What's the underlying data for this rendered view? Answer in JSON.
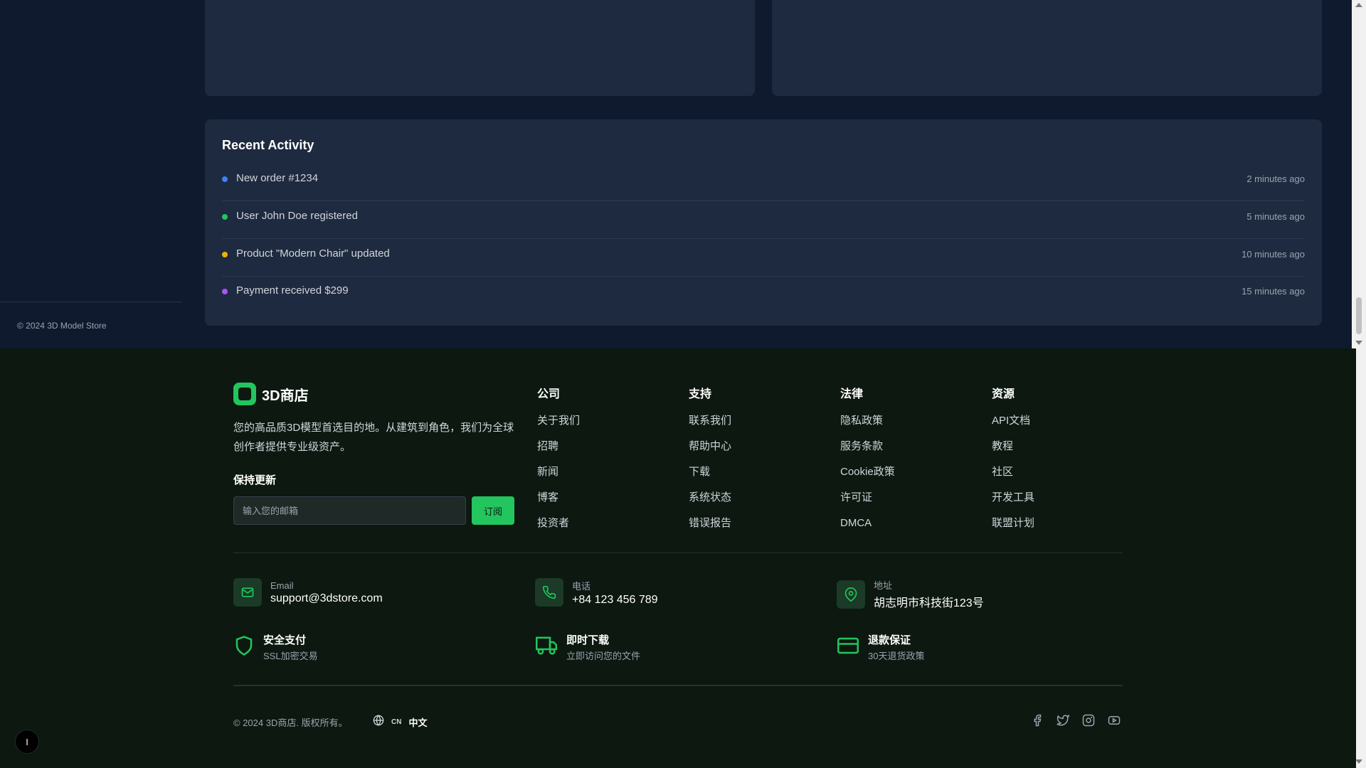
{
  "sidebar": {
    "copyright": "© 2024 3D Model Store"
  },
  "activity": {
    "title": "Recent Activity",
    "items": [
      {
        "text": "New order #1234",
        "time": "2 minutes ago",
        "color": "#3b82f6"
      },
      {
        "text": "User John Doe registered",
        "time": "5 minutes ago",
        "color": "#22c55e"
      },
      {
        "text": "Product \"Modern Chair\" updated",
        "time": "10 minutes ago",
        "color": "#eab308"
      },
      {
        "text": "Payment received $299",
        "time": "15 minutes ago",
        "color": "#a855f7"
      }
    ]
  },
  "footer": {
    "brand_name": "3D商店",
    "brand_desc": "您的高品质3D模型首选目的地。从建筑到角色，我们为全球创作者提供专业级资产。",
    "newsletter": {
      "title": "保持更新",
      "placeholder": "输入您的邮箱",
      "button": "订阅"
    },
    "columns": [
      {
        "title": "公司",
        "links": [
          "关于我们",
          "招聘",
          "新闻",
          "博客",
          "投资者"
        ]
      },
      {
        "title": "支持",
        "links": [
          "联系我们",
          "帮助中心",
          "下载",
          "系统状态",
          "错误报告"
        ]
      },
      {
        "title": "法律",
        "links": [
          "隐私政策",
          "服务条款",
          "Cookie政策",
          "许可证",
          "DMCA"
        ]
      },
      {
        "title": "资源",
        "links": [
          "API文档",
          "教程",
          "社区",
          "开发工具",
          "联盟计划"
        ]
      }
    ],
    "contacts": [
      {
        "label": "Email",
        "value": "support@3dstore.com",
        "icon": "mail-icon"
      },
      {
        "label": "电话",
        "value": "+84 123 456 789",
        "icon": "phone-icon"
      },
      {
        "label": "地址",
        "value": "胡志明市科技街123号",
        "icon": "map-pin-icon"
      }
    ],
    "features": [
      {
        "title": "安全支付",
        "sub": "SSL加密交易",
        "icon": "shield-icon"
      },
      {
        "title": "即时下载",
        "sub": "立即访问您的文件",
        "icon": "truck-icon"
      },
      {
        "title": "退款保证",
        "sub": "30天退货政策",
        "icon": "credit-card-icon"
      }
    ],
    "copyright": "© 2024 3D商店. 版权所有。",
    "lang_code": "CN",
    "lang_name": "中文",
    "accent": "#22c55e"
  },
  "floating_button": "I"
}
